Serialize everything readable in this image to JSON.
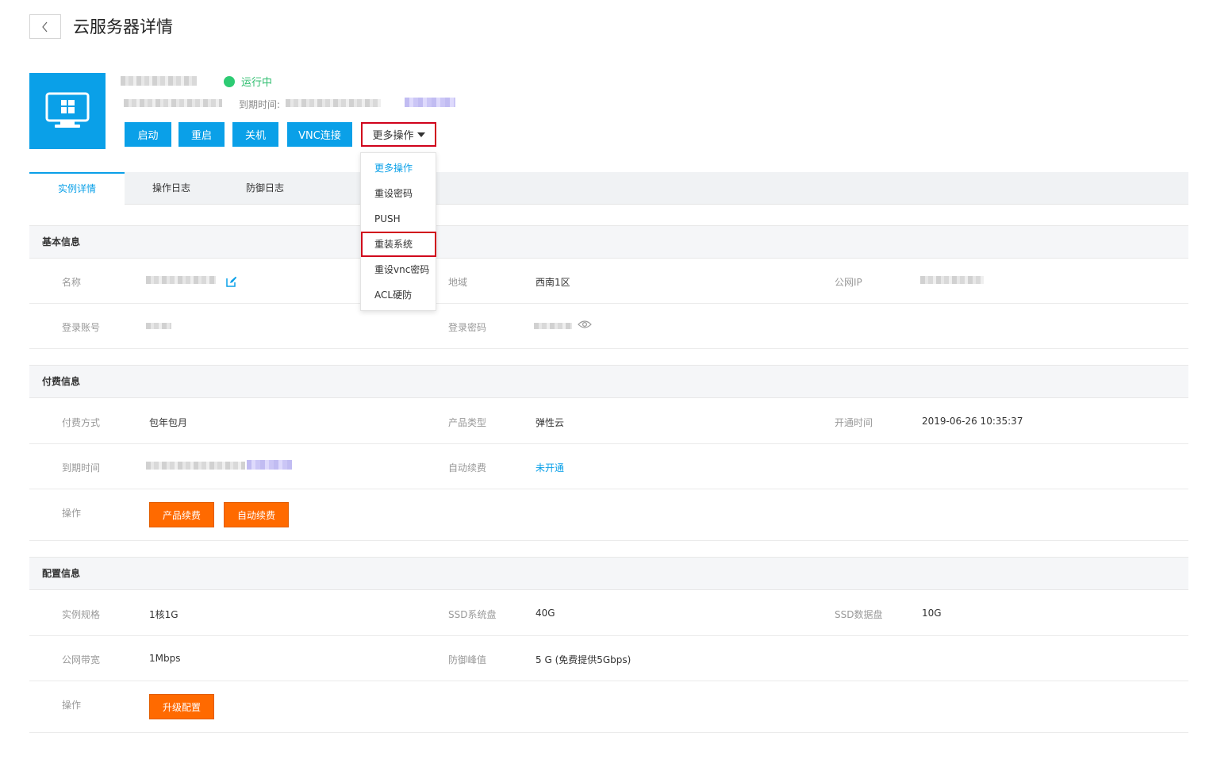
{
  "header": {
    "title": "云服务器详情"
  },
  "instance": {
    "status": "运行中",
    "expire_label": "到期时间:"
  },
  "actions": {
    "start": "启动",
    "restart": "重启",
    "shutdown": "关机",
    "vnc": "VNC连接",
    "more": "更多操作"
  },
  "dropdown": {
    "items": [
      "更多操作",
      "重设密码",
      "PUSH",
      "重装系统",
      "重设vnc密码",
      "ACL硬防"
    ]
  },
  "tabs": [
    "实例详情",
    "操作日志",
    "防御日志"
  ],
  "basic": {
    "title": "基本信息",
    "name_label": "名称",
    "region_label": "地域",
    "region_value": "西南1区",
    "ip_label": "公网IP",
    "account_label": "登录账号",
    "password_label": "登录密码"
  },
  "billing": {
    "title": "付费信息",
    "pay_label": "付费方式",
    "pay_value": "包年包月",
    "product_label": "产品类型",
    "product_value": "弹性云",
    "open_label": "开通时间",
    "open_value": "2019-06-26 10:35:37",
    "expire_label": "到期时间",
    "auto_label": "自动续费",
    "auto_value": "未开通",
    "op_label": "操作",
    "renew_btn": "产品续费",
    "auto_btn": "自动续费"
  },
  "config": {
    "title": "配置信息",
    "spec_label": "实例规格",
    "spec_value": "1核1G",
    "sys_label": "SSD系统盘",
    "sys_value": "40G",
    "data_label": "SSD数据盘",
    "data_value": "10G",
    "bw_label": "公网带宽",
    "bw_value": "1Mbps",
    "def_label": "防御峰值",
    "def_value": "5 G (免费提供5Gbps)",
    "op_label": "操作",
    "upgrade_btn": "升级配置"
  },
  "colors": {
    "primary": "#0aa0e8",
    "orange": "#ff6a00",
    "running": "#2dcb73",
    "highlight": "#d0021b"
  }
}
